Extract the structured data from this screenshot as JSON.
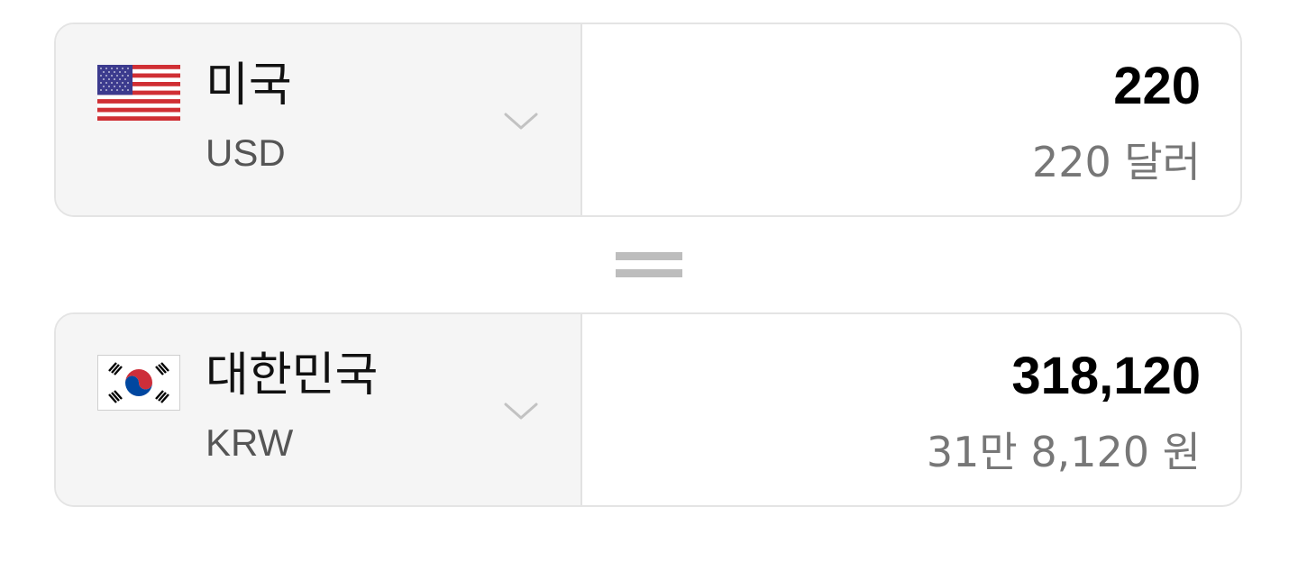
{
  "from": {
    "country": "미국",
    "code": "USD",
    "amount": "220",
    "amount_words": "220 달러",
    "flag_icon": "us-flag-icon"
  },
  "equals_symbol": "=",
  "to": {
    "country": "대한민국",
    "code": "KRW",
    "amount": "318,120",
    "amount_words": "31만 8,120 원",
    "flag_icon": "kr-flag-icon"
  },
  "colors": {
    "border": "#e4e4e4",
    "selector_bg": "#f5f5f5",
    "amount_text": "#000000",
    "secondary_text": "#777777",
    "equals_sign": "#bdbdbd"
  }
}
